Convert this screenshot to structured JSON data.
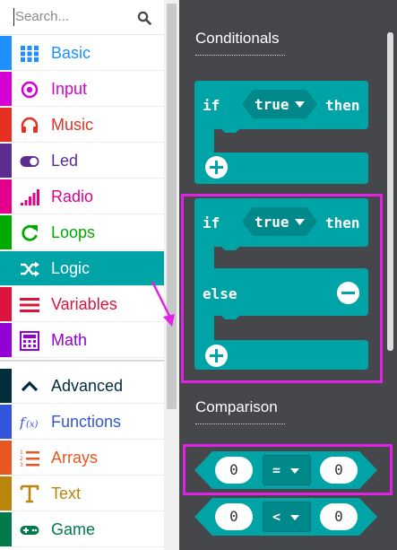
{
  "search": {
    "placeholder": "Search..."
  },
  "categories": [
    {
      "label": "Basic",
      "color": "#1e90ff",
      "icon": "grid-icon"
    },
    {
      "label": "Input",
      "color": "#d400d4",
      "icon": "target-icon"
    },
    {
      "label": "Music",
      "color": "#e63022",
      "icon": "headphones-icon"
    },
    {
      "label": "Led",
      "color": "#5c2d91",
      "icon": "toggle-icon"
    },
    {
      "label": "Radio",
      "color": "#e3008c",
      "icon": "signal-bars-icon"
    },
    {
      "label": "Loops",
      "color": "#00aa00",
      "icon": "refresh-icon"
    },
    {
      "label": "Logic",
      "color": "#00a4a6",
      "icon": "shuffle-icon",
      "selected": true
    },
    {
      "label": "Variables",
      "color": "#dc143c",
      "icon": "list-lines-icon"
    },
    {
      "label": "Math",
      "color": "#9400d3",
      "icon": "calculator-icon"
    },
    {
      "label": "Advanced",
      "color": "#002d3a",
      "icon": "chevron-up-icon"
    },
    {
      "label": "Functions",
      "color": "#3455db",
      "icon": "function-icon"
    },
    {
      "label": "Arrays",
      "color": "#e65722",
      "icon": "numbered-list-icon"
    },
    {
      "label": "Text",
      "color": "#b8860b",
      "icon": "text-t-icon"
    },
    {
      "label": "Game",
      "color": "#007a4b",
      "icon": "gamepad-icon"
    }
  ],
  "flyout": {
    "sections": {
      "conditionals": "Conditionals",
      "comparison": "Comparison"
    },
    "if_then_block": {
      "if": "if",
      "value": "true",
      "then": "then"
    },
    "if_else_block": {
      "if": "if",
      "value": "true",
      "then": "then",
      "else": "else"
    },
    "compare_eq": {
      "left": "0",
      "op": "=",
      "right": "0"
    },
    "compare_lt": {
      "left": "0",
      "op": "<",
      "right": "0"
    }
  },
  "colors": {
    "logic": "#00a4a6",
    "logic_dark": "#00888a",
    "highlight": "#e321e6",
    "flyout_bg": "#46474b"
  }
}
